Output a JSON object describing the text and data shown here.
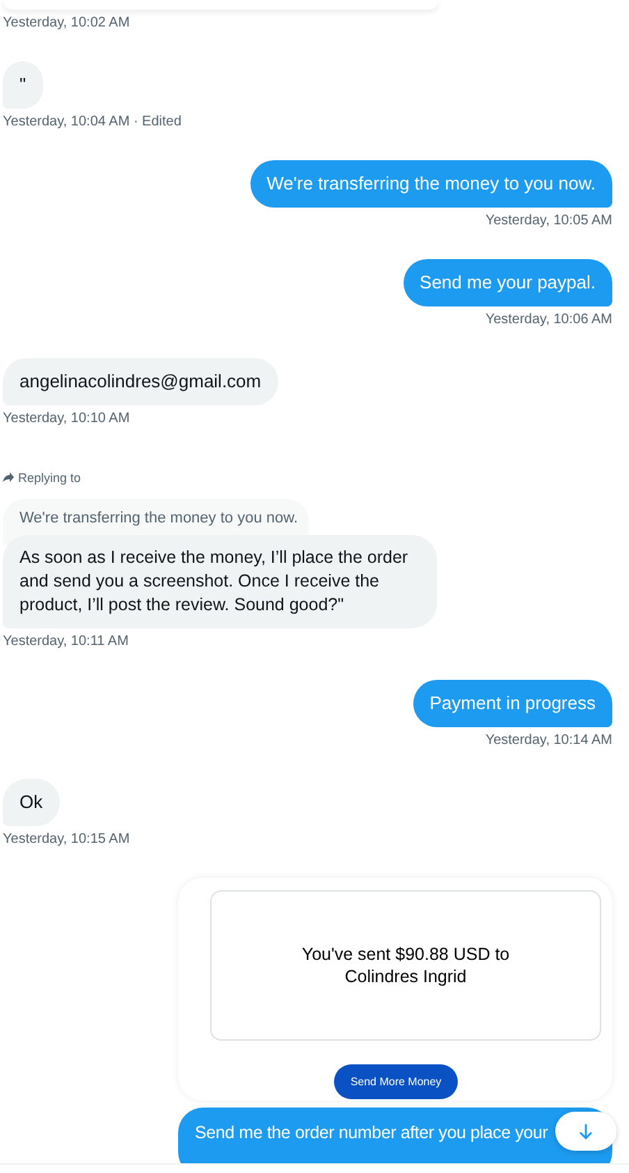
{
  "messages": [
    {
      "kind": "card_top",
      "timestamp": "Yesterday, 10:02 AM"
    },
    {
      "kind": "received",
      "text": "\"",
      "timestamp": "Yesterday, 10:04 AM · Edited"
    },
    {
      "kind": "sent",
      "text": "We're transferring the money to you now.",
      "timestamp": "Yesterday, 10:05 AM"
    },
    {
      "kind": "sent",
      "text": "Send me your paypal.",
      "timestamp": "Yesterday, 10:06 AM"
    },
    {
      "kind": "received",
      "text": "angelinacolindres@gmail.com",
      "timestamp": "Yesterday, 10:10 AM"
    },
    {
      "kind": "reply",
      "replying_label": "Replying to",
      "quoted": "We're transferring the money to you now.",
      "text": "As soon as I receive the money, I’ll place the order and send you a screenshot. Once I receive the product, I’ll post the review. Sound good?\"",
      "timestamp": "Yesterday, 10:11 AM"
    },
    {
      "kind": "sent",
      "text": "Payment in progress",
      "timestamp": "Yesterday, 10:14 AM"
    },
    {
      "kind": "received",
      "text": "Ok",
      "timestamp": "Yesterday, 10:15 AM"
    },
    {
      "kind": "payment",
      "summary": "You've sent $90.88 USD to Colindres Ingrid",
      "button": "Send More Money"
    },
    {
      "kind": "sent_cut",
      "text": "Send me the order number after you place your"
    }
  ]
}
